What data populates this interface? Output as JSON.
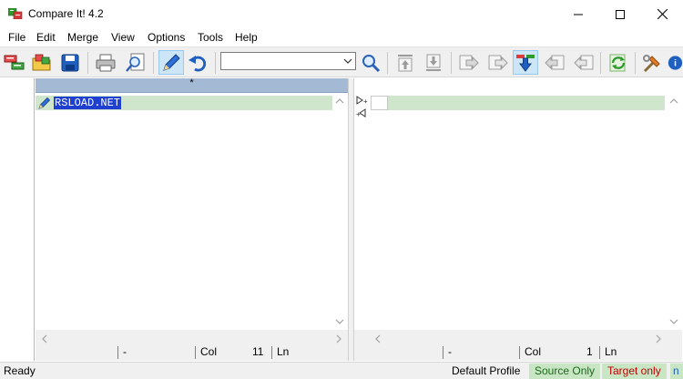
{
  "window": {
    "title": "Compare It! 4.2"
  },
  "menu": {
    "items": [
      "File",
      "Edit",
      "Merge",
      "View",
      "Options",
      "Tools",
      "Help"
    ]
  },
  "toolbar": {
    "search_value": "",
    "icons": [
      "new-compare-icon",
      "open-folder-icon",
      "save-icon",
      "print-icon",
      "find-document-icon",
      "edit-pencil-icon",
      "undo-icon",
      "search-icon",
      "first-change-icon",
      "last-change-icon",
      "copy-right-icon",
      "copy-right-2-icon",
      "next-change-icon",
      "copy-left-icon",
      "copy-left-2-icon",
      "refresh-icon",
      "tools-icon",
      "help-icon"
    ]
  },
  "left_pane": {
    "header": "*",
    "line_text": "RSLOAD.NET",
    "status": {
      "field1": "-",
      "col_label": "Col",
      "col_value": "11",
      "ln_label": "Ln"
    }
  },
  "right_pane": {
    "header": "",
    "line_text": "",
    "status": {
      "field1": "-",
      "col_label": "Col",
      "col_value": "1",
      "ln_label": "Ln"
    }
  },
  "statusbar": {
    "ready": "Ready",
    "profile": "Default Profile",
    "source_only": "Source Only",
    "target_only": "Target only",
    "extra": "n"
  },
  "colors": {
    "pane_header": "#a3b9d4",
    "diff_line": "#cfe5cc",
    "source_only_bg": "#c8e6c4",
    "source_only_fg": "#1a6a1a",
    "target_only_bg": "#c8e6c4",
    "target_only_fg": "#c00000",
    "selection": "#1e3fd0"
  }
}
